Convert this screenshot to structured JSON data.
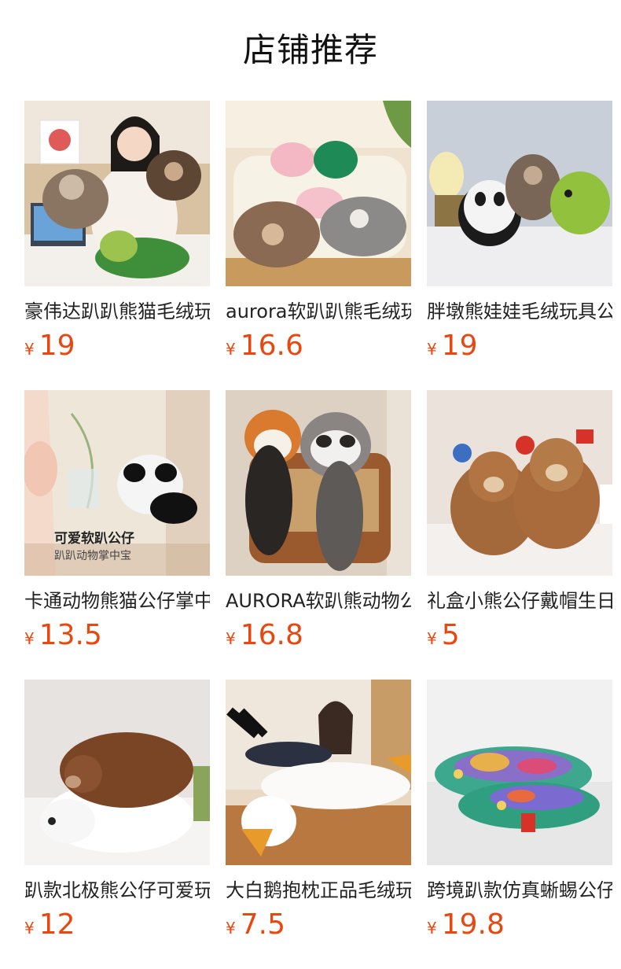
{
  "section_title": "店铺推荐",
  "currency_symbol": "¥",
  "products": [
    {
      "name": "豪伟达趴趴熊猫毛绒玩具",
      "price": "19"
    },
    {
      "name": "aurora软趴趴熊毛绒玩具",
      "price": "16.6"
    },
    {
      "name": "胖墩熊娃娃毛绒玩具公仔",
      "price": "19"
    },
    {
      "name": "卡通动物熊猫公仔掌中宝",
      "price": "13.5",
      "image_caption_main": "可爱软趴公仔",
      "image_caption_sub": "趴趴动物掌中宝"
    },
    {
      "name": "AURORA软趴熊动物公仔",
      "price": "16.8"
    },
    {
      "name": "礼盒小熊公仔戴帽生日",
      "price": "5"
    },
    {
      "name": "趴款北极熊公仔可爱玩具",
      "price": "12"
    },
    {
      "name": "大白鹅抱枕正品毛绒玩具",
      "price": "7.5"
    },
    {
      "name": "跨境趴款仿真蜥蜴公仔",
      "price": "19.8"
    }
  ],
  "colors": {
    "price": "#e8470f"
  }
}
